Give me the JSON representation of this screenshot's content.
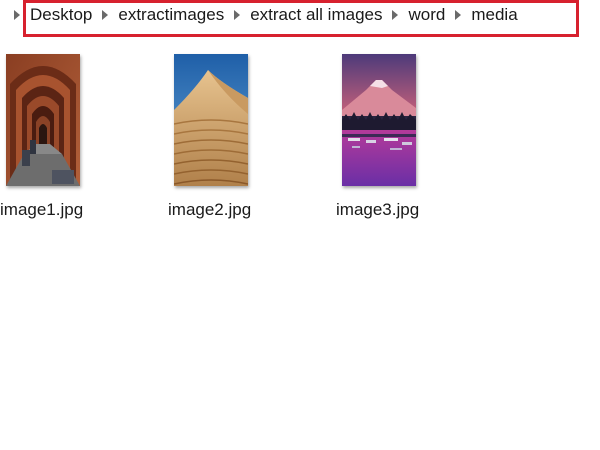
{
  "breadcrumb": {
    "items": [
      {
        "label": "Desktop"
      },
      {
        "label": "extractimages"
      },
      {
        "label": "extract all images"
      },
      {
        "label": "word"
      },
      {
        "label": "media"
      }
    ]
  },
  "files": [
    {
      "name": "image1.jpg",
      "thumbnail": "brick-archway-corridor"
    },
    {
      "name": "image2.jpg",
      "thumbnail": "desert-sand-dune"
    },
    {
      "name": "image3.jpg",
      "thumbnail": "mountain-lake-sunset"
    }
  ],
  "colors": {
    "highlight_border": "#d7212e",
    "text": "#1a1a1a",
    "chevron": "#5a5a5a"
  }
}
